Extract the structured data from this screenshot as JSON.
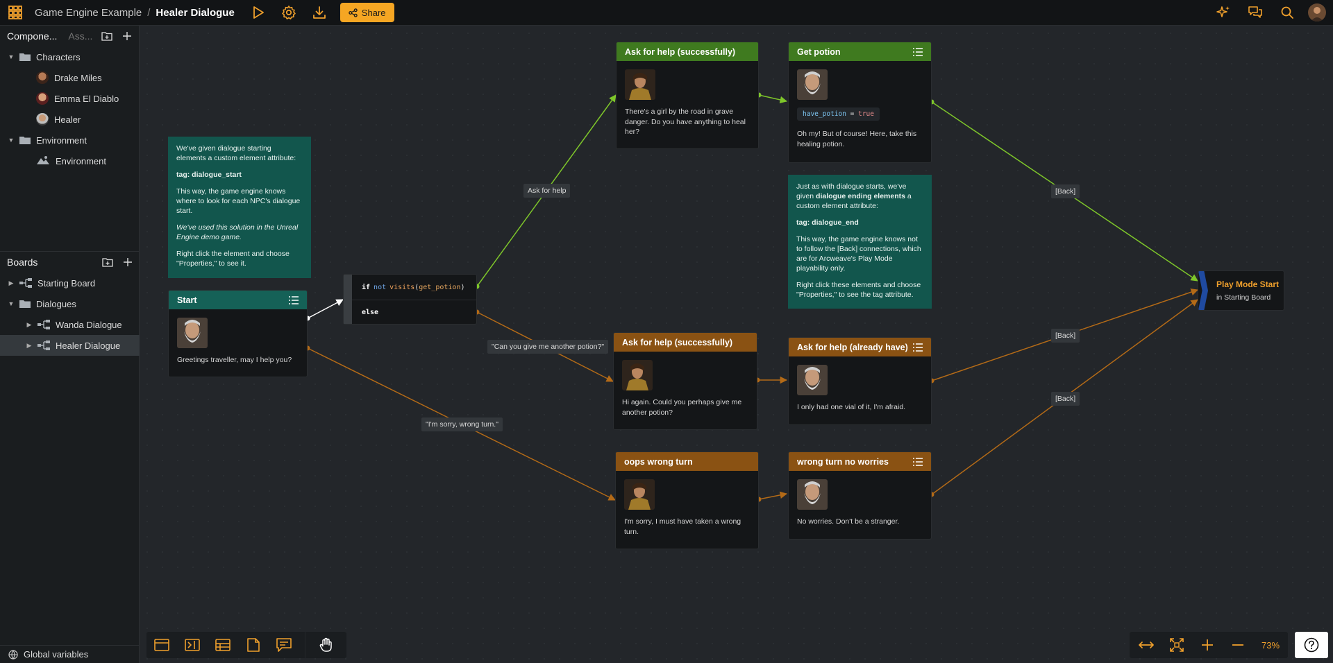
{
  "topbar": {
    "project": "Game Engine Example",
    "separator": "/",
    "board": "Healer Dialogue",
    "share_label": "Share",
    "accent": "#f5a623"
  },
  "sidebar": {
    "tab_components": "Compone...",
    "tab_assets": "Ass...",
    "tree": {
      "characters": "Characters",
      "drake": "Drake Miles",
      "emma": "Emma El Diablo",
      "healer": "Healer",
      "environment_folder": "Environment",
      "environment": "Environment"
    },
    "boards_title": "Boards",
    "boards": {
      "starting": "Starting Board",
      "dialogues": "Dialogues",
      "wanda": "Wanda Dialogue",
      "healer": "Healer Dialogue"
    },
    "global_vars": "Global variables"
  },
  "nodes": {
    "note_start": {
      "p1": "We've given dialogue starting elements a custom element attribute:",
      "p2": "tag: dialogue_start",
      "p3": "This way, the game engine knows where to look for each NPC's dialogue start.",
      "p4": "We've used this solution in the Unreal Engine demo game.",
      "p5": "Right click the element and choose \"Properties,\" to see it."
    },
    "note_end": {
      "p1a": "Just as with dialogue starts, we've given ",
      "p1b": "dialogue ending elements",
      "p1c": " a custom element attribute:",
      "p2": "tag: dialogue_end",
      "p3": "This way, the game engine knows not to follow the [Back] connections, which are for Arcweave's Play Mode playability only.",
      "p4": "Right click these elements and choose \"Properties,\" to see the tag attribute."
    },
    "start": {
      "title": "Start",
      "text": "Greetings traveller, may I help you?"
    },
    "condition": {
      "if_kw": "if",
      "not_kw": "not",
      "fn": "visits",
      "arg": "get_potion",
      "else_kw": "else"
    },
    "ask1": {
      "title": "Ask for help (successfully)",
      "text": "There's a girl by the road in grave danger. Do you have anything to heal her?"
    },
    "get_potion": {
      "title": "Get potion",
      "code_var": "have_potion",
      "code_op": " = ",
      "code_val": "true",
      "text": "Oh my! But of course! Here, take this healing potion."
    },
    "ask2": {
      "title": "Ask for help (successfully)",
      "text": "Hi again. Could you perhaps give me another potion?"
    },
    "already": {
      "title": "Ask for help (already have)",
      "text": "I only had one vial of it, I'm afraid."
    },
    "oops": {
      "title": "oops wrong turn",
      "text": "I'm sorry, I must have taken a wrong turn."
    },
    "noworries": {
      "title": "wrong turn no worries",
      "text": "No worries. Don't be a stranger."
    },
    "jump": {
      "title": "Play Mode Start",
      "sub": "in Starting Board"
    }
  },
  "labels": {
    "ask_help": "Ask for help",
    "another": "\"Can you give me another potion?\"",
    "wrong": "\"I'm sorry, wrong turn.\"",
    "back1": "[Back]",
    "back2": "[Back]",
    "back3": "[Back]"
  },
  "zoom": {
    "value": "73%"
  },
  "colors": {
    "wire_green": "#7ec62a",
    "wire_brown": "#b36a17",
    "wire_white": "#ffffff"
  }
}
